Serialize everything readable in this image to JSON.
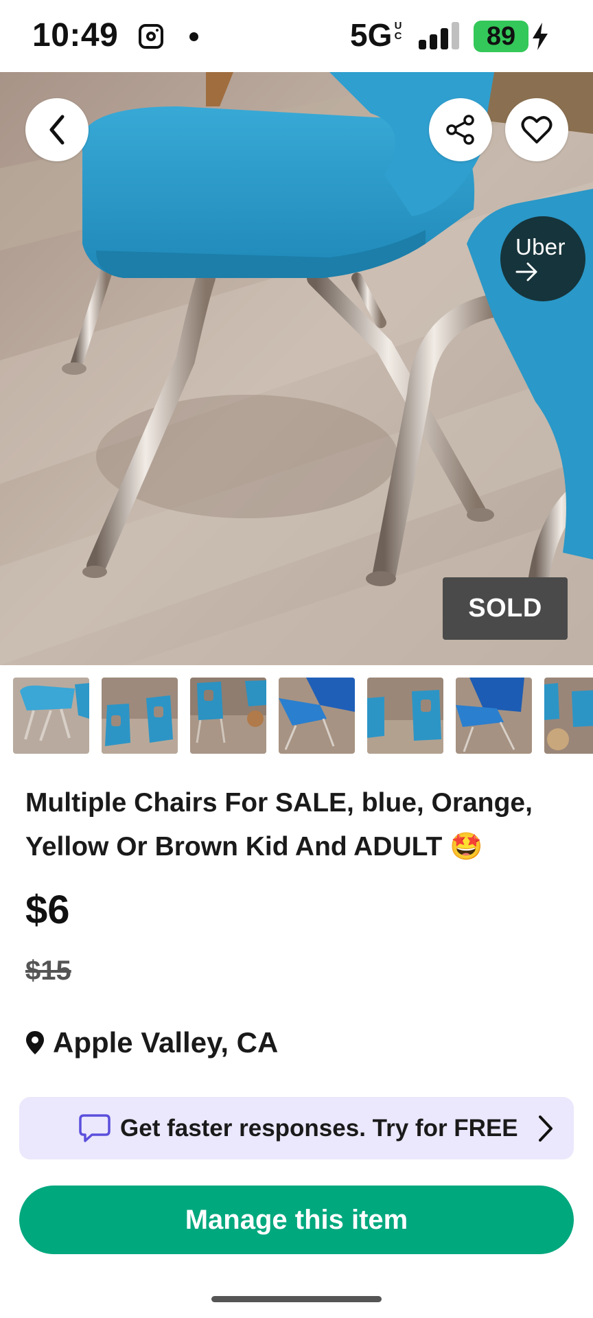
{
  "status_bar": {
    "time": "10:49",
    "network": "5G",
    "network_sub": "UC",
    "battery": "89",
    "icons": [
      "instagram-icon",
      "notification-dot",
      "signal-icon",
      "battery-icon",
      "charging-bolt-icon"
    ]
  },
  "hero": {
    "badge": "SOLD",
    "uber_label": "Uber",
    "uber_arrow": "→",
    "icons": [
      "back-chevron-icon",
      "share-icon",
      "heart-icon",
      "arrow-right-icon"
    ],
    "photo_count": 7
  },
  "listing": {
    "title": "Multiple Chairs For SALE, blue, Orange, Yellow Or Brown Kid And ADULT 🤩",
    "price": "$6",
    "original_price": "$15",
    "location": "Apple Valley, CA"
  },
  "promo": {
    "text": "Get faster responses. Try for FREE",
    "icons": [
      "chat-bubble-icon",
      "chevron-right-icon"
    ]
  },
  "actions": {
    "manage_label": "Manage this item"
  },
  "colors": {
    "accent": "#00a87e",
    "promo_bg": "#ebe7fc",
    "promo_icon": "#5a4fdc",
    "battery": "#34c759",
    "sold_badge": "#4a4a4a",
    "chair_blue": "#2f9fcf"
  }
}
